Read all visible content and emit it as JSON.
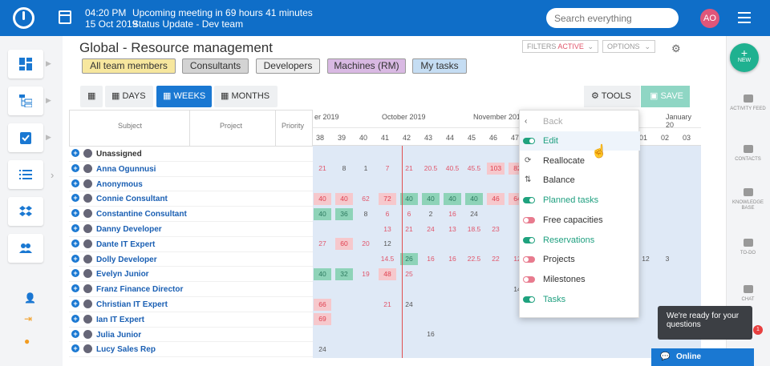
{
  "topbar": {
    "time": "04:20 PM",
    "meeting": "Upcoming meeting in 69 hours 41 minutes",
    "date": "15 Oct 2019",
    "status": "Status Update - Dev team",
    "search_placeholder": "Search everything",
    "avatar_initials": "AO"
  },
  "page": {
    "title": "Global - Resource management",
    "filters_label": "FILTERS",
    "filters_active": "ACTIVE",
    "options_label": "OPTIONS"
  },
  "chips": [
    {
      "label": "All team members",
      "bg": "#f7e79e"
    },
    {
      "label": "Consultants",
      "bg": "#d3d3d3"
    },
    {
      "label": "Developers",
      "bg": "#eeeeee"
    },
    {
      "label": "Machines (RM)",
      "bg": "#d9b9e3"
    },
    {
      "label": "My tasks",
      "bg": "#c5ddf3"
    }
  ],
  "views": {
    "days": "DAYS",
    "weeks": "WEEKS",
    "months": "MONTHS",
    "tools": "TOOLS",
    "save": "SAVE"
  },
  "columns": {
    "subject": "Subject",
    "project": "Project",
    "priority": "Priority"
  },
  "timeline": {
    "months": [
      "er 2019",
      "October 2019",
      "November 201",
      "January 20"
    ],
    "weeks": [
      "38",
      "39",
      "40",
      "41",
      "42",
      "43",
      "44",
      "45",
      "46",
      "47",
      "01",
      "02",
      "03"
    ]
  },
  "people": [
    "Unassigned",
    "Anna Ogunnusi",
    "Anonymous",
    "Connie Consultant",
    "Constantine Consultant",
    "Danny Developer",
    "Dante IT Expert",
    "Dolly Developer",
    "Evelyn Junior",
    "Franz Finance Director",
    "Christian IT Expert",
    "Ian IT Expert",
    "Julia Junior",
    "Lucy Sales Rep"
  ],
  "cells": [
    {
      "r": 1,
      "w": 0,
      "v": "21",
      "c": "pinkt"
    },
    {
      "r": 1,
      "w": 1,
      "v": "8"
    },
    {
      "r": 1,
      "w": 2,
      "v": "1"
    },
    {
      "r": 1,
      "w": 3,
      "v": "7",
      "c": "pinkt"
    },
    {
      "r": 1,
      "w": 4,
      "v": "21",
      "c": "pinkt"
    },
    {
      "r": 1,
      "w": 5,
      "v": "20.5",
      "c": "pinkt"
    },
    {
      "r": 1,
      "w": 6,
      "v": "40.5",
      "c": "pinkt"
    },
    {
      "r": 1,
      "w": 7,
      "v": "45.5",
      "c": "pinkt"
    },
    {
      "r": 1,
      "w": 8,
      "v": "103",
      "c": "red"
    },
    {
      "r": 1,
      "w": 9,
      "v": "82",
      "c": "red"
    },
    {
      "r": 3,
      "w": 0,
      "v": "40",
      "c": "red"
    },
    {
      "r": 3,
      "w": 1,
      "v": "40",
      "c": "red"
    },
    {
      "r": 3,
      "w": 2,
      "v": "62",
      "c": "pinkt"
    },
    {
      "r": 3,
      "w": 3,
      "v": "72",
      "c": "red"
    },
    {
      "r": 3,
      "w": 4,
      "v": "40",
      "c": "green"
    },
    {
      "r": 3,
      "w": 5,
      "v": "40",
      "c": "green"
    },
    {
      "r": 3,
      "w": 6,
      "v": "40",
      "c": "green"
    },
    {
      "r": 3,
      "w": 7,
      "v": "40",
      "c": "green"
    },
    {
      "r": 3,
      "w": 8,
      "v": "46",
      "c": "red"
    },
    {
      "r": 3,
      "w": 9,
      "v": "64",
      "c": "red"
    },
    {
      "r": 4,
      "w": 0,
      "v": "40",
      "c": "green"
    },
    {
      "r": 4,
      "w": 1,
      "v": "36",
      "c": "green"
    },
    {
      "r": 4,
      "w": 2,
      "v": "8"
    },
    {
      "r": 4,
      "w": 3,
      "v": "6",
      "c": "pinkt"
    },
    {
      "r": 4,
      "w": 4,
      "v": "6",
      "c": "pinkt"
    },
    {
      "r": 4,
      "w": 5,
      "v": "2"
    },
    {
      "r": 4,
      "w": 6,
      "v": "16",
      "c": "pinkt"
    },
    {
      "r": 4,
      "w": 7,
      "v": "24"
    },
    {
      "r": 5,
      "w": 3,
      "v": "13",
      "c": "pinkt"
    },
    {
      "r": 5,
      "w": 4,
      "v": "21",
      "c": "pinkt"
    },
    {
      "r": 5,
      "w": 5,
      "v": "24",
      "c": "pinkt"
    },
    {
      "r": 5,
      "w": 6,
      "v": "13",
      "c": "pinkt"
    },
    {
      "r": 5,
      "w": 7,
      "v": "18.5",
      "c": "pinkt"
    },
    {
      "r": 5,
      "w": 8,
      "v": "23",
      "c": "pinkt"
    },
    {
      "r": 6,
      "w": 0,
      "v": "27",
      "c": "pinkt"
    },
    {
      "r": 6,
      "w": 1,
      "v": "60",
      "c": "red"
    },
    {
      "r": 6,
      "w": 2,
      "v": "20",
      "c": "pinkt"
    },
    {
      "r": 6,
      "w": 3,
      "v": "12"
    },
    {
      "r": 7,
      "w": 3,
      "v": "14.5",
      "c": "pinkt"
    },
    {
      "r": 7,
      "w": 4,
      "v": "26",
      "c": "green"
    },
    {
      "r": 7,
      "w": 5,
      "v": "16",
      "c": "pinkt"
    },
    {
      "r": 7,
      "w": 6,
      "v": "16",
      "c": "pinkt"
    },
    {
      "r": 7,
      "w": 7,
      "v": "22.5",
      "c": "pinkt"
    },
    {
      "r": 7,
      "w": 8,
      "v": "22",
      "c": "pinkt"
    },
    {
      "r": 7,
      "w": 9,
      "v": "12",
      "c": "pinkt"
    },
    {
      "r": 7,
      "w": 10,
      "v": "12"
    },
    {
      "r": 7,
      "w": 11,
      "v": "3"
    },
    {
      "r": 8,
      "w": 0,
      "v": "40",
      "c": "green"
    },
    {
      "r": 8,
      "w": 1,
      "v": "32",
      "c": "green"
    },
    {
      "r": 8,
      "w": 2,
      "v": "19",
      "c": "pinkt"
    },
    {
      "r": 8,
      "w": 3,
      "v": "48",
      "c": "red"
    },
    {
      "r": 8,
      "w": 4,
      "v": "25",
      "c": "pinkt"
    },
    {
      "r": 9,
      "w": 9,
      "v": "14"
    },
    {
      "r": 10,
      "w": 0,
      "v": "66",
      "c": "red"
    },
    {
      "r": 10,
      "w": 3,
      "v": "21",
      "c": "pinkt"
    },
    {
      "r": 10,
      "w": 4,
      "v": "24"
    },
    {
      "r": 11,
      "w": 0,
      "v": "69",
      "c": "red"
    },
    {
      "r": 12,
      "w": 5,
      "v": "16"
    },
    {
      "r": 13,
      "w": 0,
      "v": "24"
    }
  ],
  "dropdown": {
    "back": "Back",
    "items": [
      {
        "label": "Edit",
        "kind": "on"
      },
      {
        "label": "Reallocate",
        "kind": "icon"
      },
      {
        "label": "Balance",
        "kind": "icon"
      },
      {
        "label": "Planned tasks",
        "kind": "on"
      },
      {
        "label": "Free capacities",
        "kind": "off"
      },
      {
        "label": "Reservations",
        "kind": "on"
      },
      {
        "label": "Projects",
        "kind": "off"
      },
      {
        "label": "Milestones",
        "kind": "off"
      },
      {
        "label": "Tasks",
        "kind": "on"
      }
    ]
  },
  "right_sidebar": {
    "new": "NEW",
    "activity": "ACTIVITY FEED",
    "contacts": "CONTACTS",
    "kb": "KNOWLEDGE BASE",
    "todo": "TO-DO",
    "chat": "CHAT",
    "badge": "1"
  },
  "chat": {
    "bubble": "We're ready for your questions",
    "online": "Online"
  }
}
